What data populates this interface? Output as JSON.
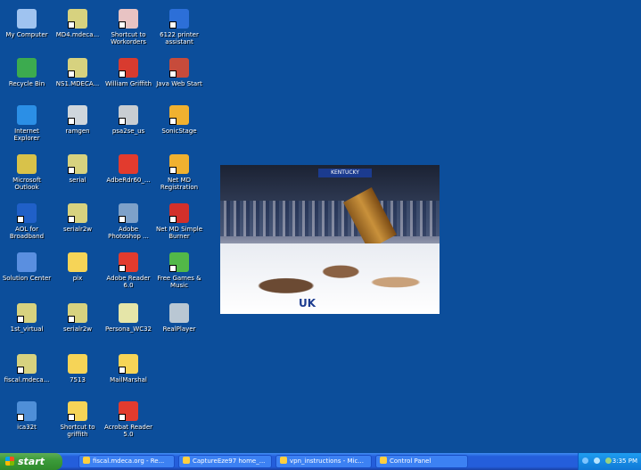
{
  "desktop": {
    "background_color": "#0c4e9b",
    "icons": [
      {
        "label": "My Computer",
        "icon": "computer-icon",
        "color": "#9fc3f0",
        "shortcut": false
      },
      {
        "label": "MD4.mdeca...",
        "icon": "network-terminal-icon",
        "color": "#d7d27f",
        "shortcut": true
      },
      {
        "label": "Shortcut to Workorders",
        "icon": "document-icon",
        "color": "#e8c3c3",
        "shortcut": true
      },
      {
        "label": "6122 printer assistant",
        "icon": "hp-printer-icon",
        "color": "#2c6fd8",
        "shortcut": true
      },
      {
        "label": "Recycle Bin",
        "icon": "recycle-bin-icon",
        "color": "#3cab4f",
        "shortcut": false
      },
      {
        "label": "NS1.MDECA...",
        "icon": "network-terminal-icon",
        "color": "#d7d27f",
        "shortcut": true
      },
      {
        "label": "William Griffith",
        "icon": "pdf-icon",
        "color": "#d83b2f",
        "shortcut": true
      },
      {
        "label": "Java Web Start",
        "icon": "java-icon",
        "color": "#c74b3b",
        "shortcut": true
      },
      {
        "label": "Internet Explorer",
        "icon": "internet-explorer-icon",
        "color": "#2b8fe6",
        "shortcut": false
      },
      {
        "label": "ramgen",
        "icon": "realplayer-icon",
        "color": "#cfd6dc",
        "shortcut": true
      },
      {
        "label": "psa2se_us",
        "icon": "installer-icon",
        "color": "#c8cdd2",
        "shortcut": true
      },
      {
        "label": "SonicStage",
        "icon": "sonicstage-icon",
        "color": "#f0b130",
        "shortcut": true
      },
      {
        "label": "Microsoft Outlook",
        "icon": "outlook-icon",
        "color": "#d8c24a",
        "shortcut": false
      },
      {
        "label": "serial",
        "icon": "network-terminal-icon",
        "color": "#d7d27f",
        "shortcut": true
      },
      {
        "label": "AdbeRdr60_...",
        "icon": "adobe-reader-icon",
        "color": "#e23b2e",
        "shortcut": false
      },
      {
        "label": "Net MD Registration",
        "icon": "netmd-icon",
        "color": "#f0b130",
        "shortcut": true
      },
      {
        "label": "AOL for Broadband",
        "icon": "aol-icon",
        "color": "#2060c8",
        "shortcut": true
      },
      {
        "label": "serialr2w",
        "icon": "network-terminal-icon",
        "color": "#d7d27f",
        "shortcut": true
      },
      {
        "label": "Adobe Photoshop ...",
        "icon": "photoshop-icon",
        "color": "#7ea1c9",
        "shortcut": true
      },
      {
        "label": "Net MD Simple Burner",
        "icon": "netmd-burner-icon",
        "color": "#d2302a",
        "shortcut": true
      },
      {
        "label": "Solution Center",
        "icon": "solution-center-icon",
        "color": "#5a8fe0",
        "shortcut": false
      },
      {
        "label": "pix",
        "icon": "folder-icon",
        "color": "#f6d457",
        "shortcut": false
      },
      {
        "label": "Adobe Reader 6.0",
        "icon": "adobe-reader-icon",
        "color": "#e23b2e",
        "shortcut": true
      },
      {
        "label": "Free Games & Music",
        "icon": "games-icon",
        "color": "#52b848",
        "shortcut": true
      },
      {
        "label": "1st_virtual",
        "icon": "network-terminal-icon",
        "color": "#d7d27f",
        "shortcut": true
      },
      {
        "label": "serialr2w",
        "icon": "network-terminal-icon",
        "color": "#d7d27f",
        "shortcut": true
      },
      {
        "label": "Persona_WC32",
        "icon": "application-icon",
        "color": "#e5e5a8",
        "shortcut": false
      },
      {
        "label": "RealPlayer",
        "icon": "realplayer-icon",
        "color": "#b9c7d3",
        "shortcut": false
      },
      {
        "label": "fiscal.mdeca...",
        "icon": "network-terminal-icon",
        "color": "#d7d27f",
        "shortcut": true
      },
      {
        "label": "7513",
        "icon": "folder-icon",
        "color": "#f6d457",
        "shortcut": false
      },
      {
        "label": "MailMarshal",
        "icon": "folder-icon",
        "color": "#f6d457",
        "shortcut": true
      },
      {
        "label": "ica32t",
        "icon": "citrix-icon",
        "color": "#4f8fd8",
        "shortcut": true
      },
      {
        "label": "Shortcut to griffith",
        "icon": "folder-icon",
        "color": "#f6d457",
        "shortcut": true
      },
      {
        "label": "Acrobat Reader 5.0",
        "icon": "acrobat-icon",
        "color": "#e23b2e",
        "shortcut": true
      }
    ],
    "photo": {
      "banner_text": "KENTUCKY",
      "jersey_text": "UK"
    }
  },
  "taskbar": {
    "start_label": "start",
    "tasks": [
      {
        "label": "fiscal.mdeca.org - Re...",
        "icon": "network-terminal-icon"
      },
      {
        "label": "CaptureEze97 home_...",
        "icon": "capture-icon"
      },
      {
        "label": "vpn_instructions - Mic...",
        "icon": "word-icon"
      },
      {
        "label": "Control Panel",
        "icon": "control-panel-icon"
      }
    ],
    "tray": {
      "clock": "3:35 PM"
    }
  }
}
